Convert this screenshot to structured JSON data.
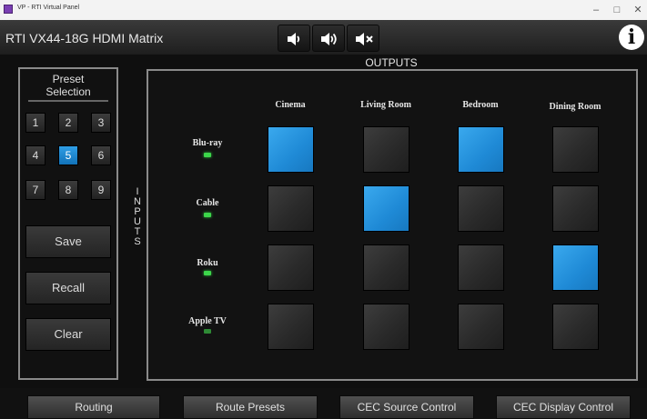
{
  "window": {
    "title": "VP - RTI Virtual Panel",
    "controls": [
      "–",
      "□",
      "✕"
    ]
  },
  "header": {
    "app_title": "RTI VX44-18G HDMI Matrix",
    "buttons": [
      "volume-down-icon",
      "volume-up-icon",
      "mute-icon"
    ],
    "info_glyph": "i"
  },
  "preset": {
    "title_line1": "Preset",
    "title_line2": "Selection",
    "numbers": [
      "1",
      "2",
      "3",
      "4",
      "5",
      "6",
      "7",
      "8",
      "9"
    ],
    "selected": "5",
    "save": "Save",
    "recall": "Recall",
    "clear": "Clear"
  },
  "matrix": {
    "outputs_label": "OUTPUTS",
    "inputs_label": [
      "I",
      "N",
      "P",
      "U",
      "T",
      "S"
    ],
    "outputs": [
      "Cinema",
      "Living Room",
      "Bedroom",
      "Dining Room"
    ],
    "inputs": [
      "Blu-ray",
      "Cable",
      "Roku",
      "Apple TV"
    ],
    "routes": [
      [
        true,
        false,
        true,
        false
      ],
      [
        false,
        true,
        false,
        false
      ],
      [
        false,
        false,
        false,
        true
      ],
      [
        false,
        false,
        false,
        false
      ]
    ]
  },
  "tabs": [
    "Routing",
    "Route Presets",
    "CEC Source Control",
    "CEC Display Control"
  ],
  "colors": {
    "accent_blue": "#1f8ad6",
    "led_green": "#3cd64a"
  }
}
